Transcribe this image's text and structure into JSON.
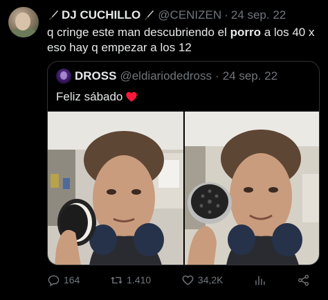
{
  "tweet": {
    "author_name": "DJ CUCHILLO",
    "author_handle": "@CENIZEN",
    "separator": "·",
    "date": "24 sep. 22",
    "text_before": "q cringe este man descubriendo el ",
    "text_bold": "porro",
    "text_after": " a los 40 x eso hay q empezar a los 12"
  },
  "quoted": {
    "author_name": "DROSS",
    "author_handle": "@eldiariodedross",
    "separator": "·",
    "date": "24 sep. 22",
    "text": "Feliz sábado"
  },
  "actions": {
    "replies": "164",
    "retweets": "1.410",
    "likes": "34,2K"
  },
  "icons": [
    "knife-icon",
    "heart-emoji-icon",
    "reply-icon",
    "retweet-icon",
    "like-icon",
    "views-icon",
    "share-icon"
  ],
  "colors": {
    "background": "#000000",
    "text": "#e7e9ea",
    "secondary": "#71767b",
    "border": "#2f3336",
    "heart": "#f91838"
  }
}
